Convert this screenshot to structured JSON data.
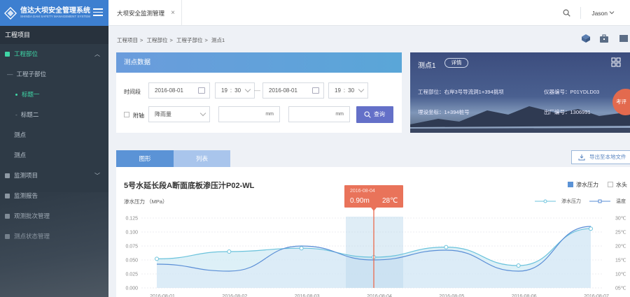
{
  "app": {
    "title": "信达大坝安全管理系统",
    "subtitle": "SHINDA DAM SAFETY MANAGEMENT SYSTEM"
  },
  "sidebar": {
    "header": "工程项目",
    "items": [
      {
        "label": "工程部位",
        "level": 0,
        "active": true,
        "expanded": true
      },
      {
        "label": "工程子部位",
        "level": 1,
        "active": false
      },
      {
        "label": "标题一",
        "level": 2,
        "active": true
      },
      {
        "label": "标题二",
        "level": 2,
        "active": false
      },
      {
        "label": "测点",
        "level": 3,
        "active": false
      },
      {
        "label": "测点",
        "level": 3,
        "active": false
      },
      {
        "label": "监测项目",
        "level": 0,
        "active": false
      },
      {
        "label": "监测报告",
        "level": 0,
        "active": false
      },
      {
        "label": "观测批次管理",
        "level": 0,
        "active": false
      },
      {
        "label": "测点状态管理",
        "level": 0,
        "active": false
      }
    ]
  },
  "topbar": {
    "tab_label": "大坝安全监测管理",
    "close": "×",
    "user": "Jason"
  },
  "breadcrumb": [
    "工程项目",
    ">",
    "工程部位",
    ">",
    "工程子部位",
    ">",
    "测点1"
  ],
  "filter": {
    "title": "测点数据",
    "time_label": "时间段",
    "start_date": "2016-08-01",
    "start_hour": "19",
    "start_min": "30",
    "range_sep": "—",
    "end_date": "2016-08-01",
    "end_hour": "19",
    "end_min": "30",
    "time_colon": ":",
    "axis_label": "附轴",
    "axis_select": "降雨量",
    "unit1": "mm",
    "unit2": "mm",
    "query": "查询"
  },
  "point_card": {
    "title": "测点1",
    "detail": "详情",
    "part_label": "工程部位：",
    "part_value": "右岸3号导流洞1+394挑坝",
    "instrument_label": "仪器编号：",
    "instrument_value": "P01YDLD03",
    "coord_label": "埋设坐标：",
    "coord_value": "1+394桩号",
    "factory_label": "出厂编号：",
    "factory_value": "1306991",
    "badge": "考评"
  },
  "view_tabs": {
    "graph": "图形",
    "list": "列表",
    "export": "导出至本地文件"
  },
  "chart_legend": {
    "seepage_check": "渗水压力",
    "water_check": "水头"
  },
  "tooltip": {
    "date": "2016-08-04",
    "value": "0.90m",
    "temp": "28℃"
  },
  "colors": {
    "primary": "#5b93d6",
    "accent": "#3fd6a6",
    "tooltip": "#e9735a",
    "sidebar": "#2e3a46",
    "series_pressure": "#6bc3dc",
    "series_temp": "#5a8ed6"
  },
  "chart_data": {
    "type": "line",
    "title": "5号水延长段A断面底板渗压汁P02-WL",
    "ylabel": "渗水压力 （MPa）",
    "y_ticks": [
      "0.125",
      "0.100",
      "0.075",
      "0.050",
      "0.025",
      "0.000"
    ],
    "y2_ticks": [
      "30℃",
      "25℃",
      "20℃",
      "15℃",
      "10℃",
      "05℃"
    ],
    "ylim": [
      0,
      0.125
    ],
    "y2lim": [
      5,
      30
    ],
    "x_ticks": [
      "2016-08-01",
      "2016-08-02",
      "2016-08-03",
      "2016-08-04",
      "2016-08-05",
      "2016-08-06",
      "2016-08-07"
    ],
    "legend": [
      "渗水压力",
      "温度"
    ],
    "legend_position": "top-right",
    "grid": true,
    "series": [
      {
        "name": "渗水压力",
        "points": [
          {
            "x": "2016-08-01",
            "y": 0.052
          },
          {
            "x": "2016-08-02",
            "y": 0.065
          },
          {
            "x": "2016-08-03",
            "y": 0.071
          },
          {
            "x": "2016-08-04",
            "y": 0.055
          },
          {
            "x": "2016-08-05",
            "y": 0.073
          },
          {
            "x": "2016-08-06",
            "y": 0.04
          },
          {
            "x": "2016-08-07",
            "y": 0.106
          }
        ]
      },
      {
        "name": "温度",
        "points": [
          {
            "x": "2016-08-01",
            "y": 13.5
          },
          {
            "x": "2016-08-02",
            "y": 11.0
          },
          {
            "x": "2016-08-03",
            "y": 20.0
          },
          {
            "x": "2016-08-04",
            "y": 15.0
          },
          {
            "x": "2016-08-05",
            "y": 18.5
          },
          {
            "x": "2016-08-06",
            "y": 11.0
          },
          {
            "x": "2016-08-07",
            "y": 27.0
          }
        ]
      }
    ]
  }
}
